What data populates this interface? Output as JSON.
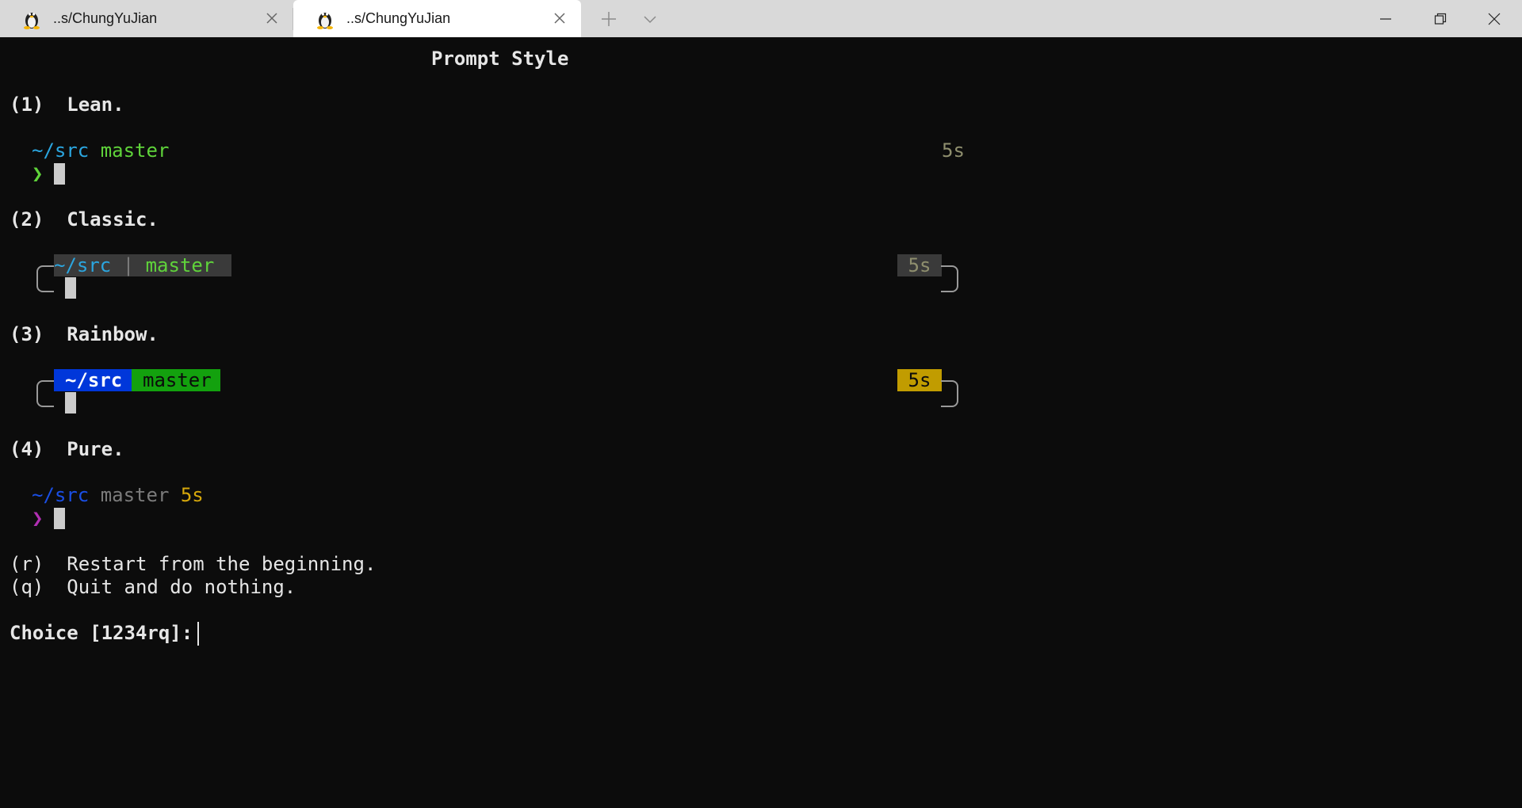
{
  "window": {
    "tabs": [
      {
        "title": "..s/ChungYuJian",
        "icon": "linux-tux-icon",
        "active": false
      },
      {
        "title": "..s/ChungYuJian",
        "icon": "linux-tux-icon",
        "active": true
      }
    ],
    "controls": [
      "new-tab-icon",
      "tab-dropdown-icon",
      "minimize-icon",
      "restore-icon",
      "close-icon"
    ]
  },
  "terminal": {
    "heading": "Prompt Style",
    "options": [
      {
        "key": "(1)",
        "label": "Lean."
      },
      {
        "key": "(2)",
        "label": "Classic."
      },
      {
        "key": "(3)",
        "label": "Rainbow."
      },
      {
        "key": "(4)",
        "label": "Pure."
      }
    ],
    "lean": {
      "dir": "~/src",
      "branch": "master",
      "time": "5s",
      "prompt_char": "❯"
    },
    "classic": {
      "dir": "~/src",
      "separator": "|",
      "branch": "master",
      "time": "5s"
    },
    "rainbow": {
      "dir": "~/src",
      "branch": "master",
      "time": "5s"
    },
    "pure": {
      "dir": "~/src",
      "branch": "master",
      "time": "5s",
      "prompt_char": "❯"
    },
    "extra_options": [
      {
        "key": "(r)",
        "label": "Restart from the beginning."
      },
      {
        "key": "(q)",
        "label": "Quit and do nothing."
      }
    ],
    "choice_prompt": "Choice [1234rq]:",
    "colors": {
      "background": "#0c0c0c",
      "cyan": "#2ba6e0",
      "green": "#5fd33a",
      "rainbow_blue": "#0037da",
      "rainbow_green": "#13a10e",
      "rainbow_yellow": "#c19c00",
      "pure_magenta": "#b12fb3"
    }
  }
}
